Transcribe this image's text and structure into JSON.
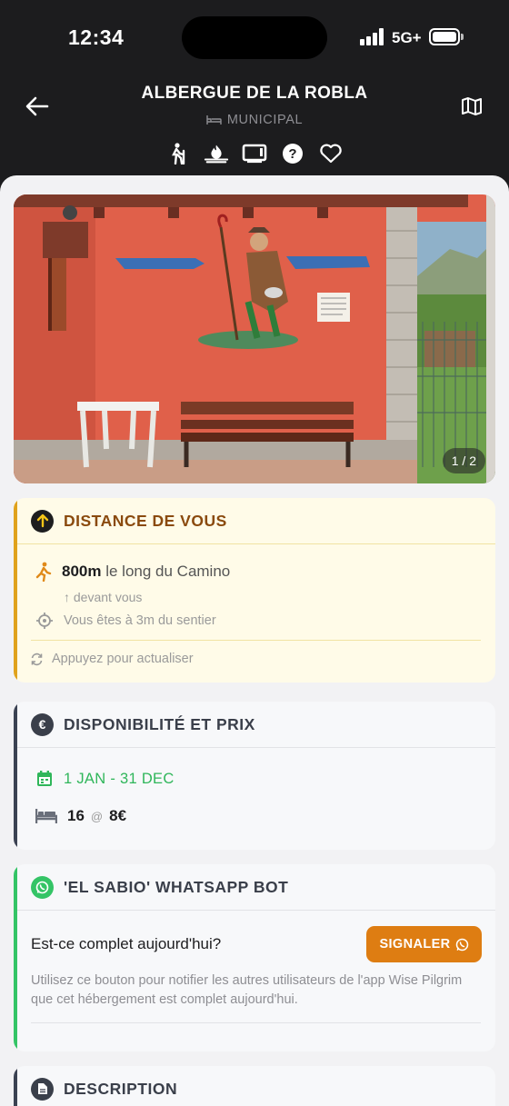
{
  "status_bar": {
    "time": "12:34",
    "network": "5G+"
  },
  "header": {
    "title": "ALBERGUE DE LA ROBLA",
    "subtitle": "MUNICIPAL",
    "amenities": [
      "hiker-icon",
      "fire-icon",
      "tv-icon",
      "question-icon",
      "heart-icon"
    ]
  },
  "photo": {
    "counter": "1 / 2"
  },
  "distance": {
    "title": "DISTANCE DE VOUS",
    "distance_value": "800m",
    "distance_suffix": "le long du Camino",
    "direction": "↑ devant vous",
    "path_note": "Vous êtes à 3m du sentier",
    "refresh": "Appuyez pour actualiser"
  },
  "availability": {
    "title": "DISPONIBILITÉ ET PRIX",
    "dates": "1 JAN - 31 DEC",
    "beds": "16",
    "at": "@",
    "price": "8€"
  },
  "whatsapp": {
    "title": "'EL SABIO' WHATSAPP BOT",
    "question": "Est-ce complet aujourd'hui?",
    "button": "SIGNALER",
    "description": "Utilisez ce bouton pour notifier les autres utilisateurs de l'app Wise Pilgrim que cet hébergement est complet aujourd'hui."
  },
  "description": {
    "title": "DESCRIPTION"
  },
  "colors": {
    "distance_accent": "#e0a21c",
    "whatsapp_green": "#34c466",
    "dates_green": "#2fb65a",
    "button_orange": "#de7d12"
  }
}
